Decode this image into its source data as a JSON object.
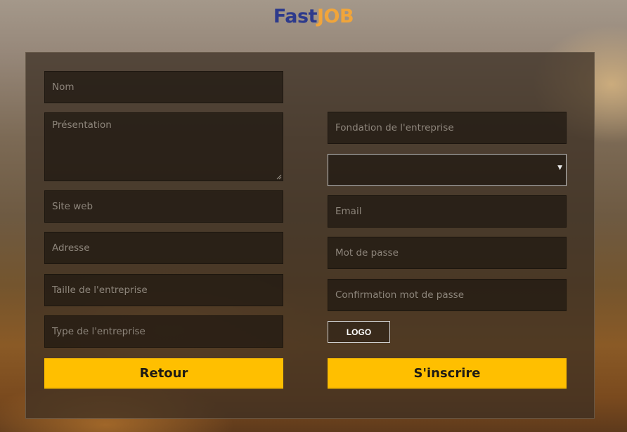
{
  "brand": {
    "part1": "Fast",
    "part2": "JOB"
  },
  "form": {
    "left": {
      "nom": "Nom",
      "presentation": "Présentation",
      "site_web": "Site web",
      "adresse": "Adresse",
      "taille": "Taille de l'entreprise",
      "type": "Type de l'entreprise"
    },
    "right": {
      "fondation": "Fondation de l'entreprise",
      "select_value": "",
      "email": "Email",
      "mot_de_passe": "Mot de passe",
      "confirmation": "Confirmation mot de passe",
      "logo_button": "LOGO"
    },
    "buttons": {
      "retour": "Retour",
      "inscrire": "S'inscrire"
    }
  },
  "colors": {
    "accent": "#ffbf00",
    "brand_blue": "#2d3a8c",
    "brand_orange": "#f1a53a"
  }
}
